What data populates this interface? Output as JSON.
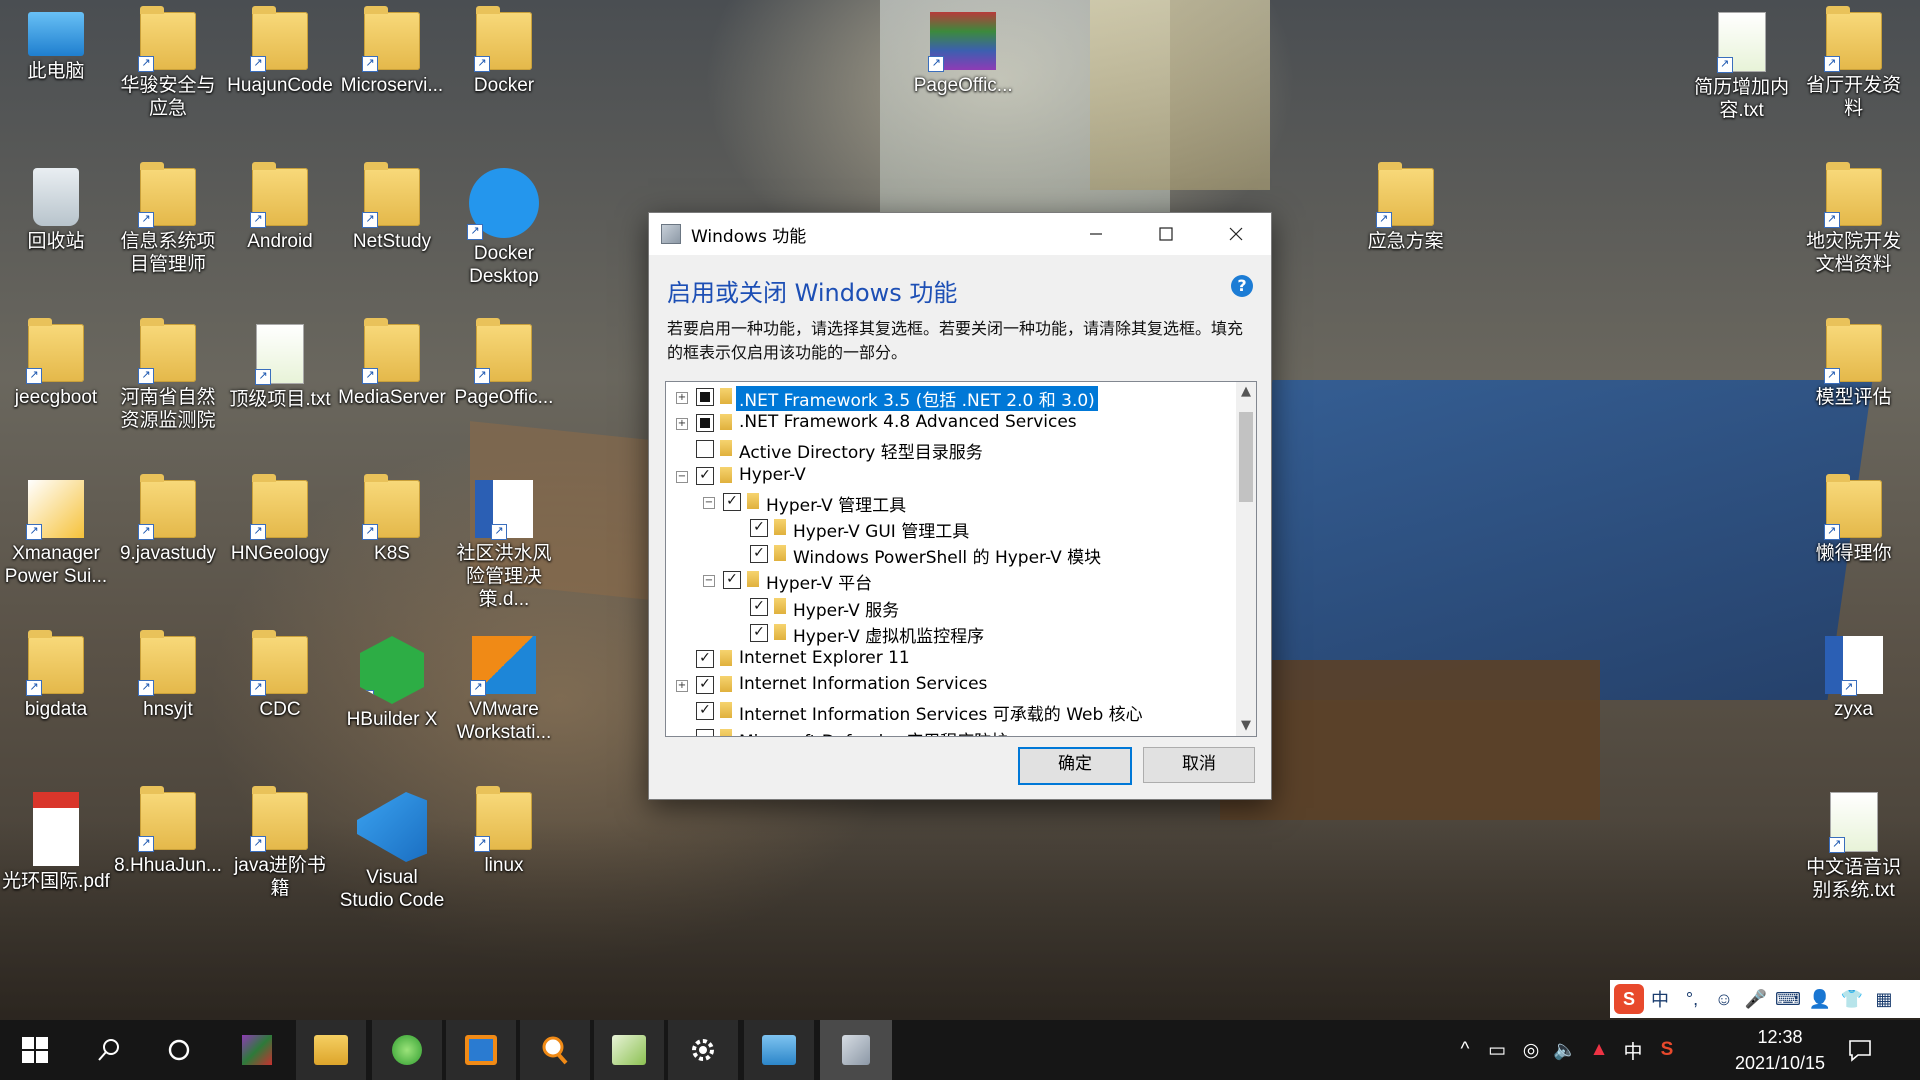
{
  "desktop": {
    "icons": [
      {
        "label": "此电脑"
      },
      {
        "label": "华骏安全与应急"
      },
      {
        "label": "HuajunCode"
      },
      {
        "label": "Microservi..."
      },
      {
        "label": "Docker"
      },
      {
        "label": "PageOffic..."
      },
      {
        "label": "简历增加内容.txt"
      },
      {
        "label": "省厅开发资料"
      },
      {
        "label": "回收站"
      },
      {
        "label": "信息系统项目管理师"
      },
      {
        "label": "Android"
      },
      {
        "label": "NetStudy"
      },
      {
        "label": "Docker Desktop"
      },
      {
        "label": "应急方案"
      },
      {
        "label": "地灾院开发文档资料"
      },
      {
        "label": "jeecgboot"
      },
      {
        "label": "河南省自然资源监测院"
      },
      {
        "label": "顶级项目.txt"
      },
      {
        "label": "MediaServer"
      },
      {
        "label": "PageOffic..."
      },
      {
        "label": "模型评估"
      },
      {
        "label": "Xmanager Power Sui..."
      },
      {
        "label": "9.javastudy"
      },
      {
        "label": "HNGeology"
      },
      {
        "label": "K8S"
      },
      {
        "label": "社区洪水风险管理决策.d..."
      },
      {
        "label": "懒得理你"
      },
      {
        "label": "bigdata"
      },
      {
        "label": "hnsyjt"
      },
      {
        "label": "CDC"
      },
      {
        "label": "HBuilder X"
      },
      {
        "label": "VMware Workstati..."
      },
      {
        "label": "zyxa"
      },
      {
        "label": "光环国际.pdf"
      },
      {
        "label": "8.HhuaJun..."
      },
      {
        "label": "java进阶书籍"
      },
      {
        "label": "Visual Studio Code"
      },
      {
        "label": "linux"
      },
      {
        "label": "中文语音识别系统.txt"
      }
    ]
  },
  "dialog": {
    "title": "Windows 功能",
    "heading": "启用或关闭 Windows 功能",
    "help": "?",
    "description": "若要启用一种功能，请选择其复选框。若要关闭一种功能，请清除其复选框。填充的框表示仅启用该功能的一部分。",
    "features": [
      {
        "label": ".NET Framework 3.5 (包括 .NET 2.0 和 3.0)",
        "state": "partial",
        "expander": "+",
        "selected": true
      },
      {
        "label": ".NET Framework 4.8 Advanced Services",
        "state": "partial",
        "expander": "+"
      },
      {
        "label": "Active Directory 轻型目录服务",
        "state": "unchecked",
        "expander": ""
      },
      {
        "label": "Hyper-V",
        "state": "checked",
        "expander": "−"
      },
      {
        "label": "Hyper-V 管理工具",
        "state": "checked",
        "expander": "−"
      },
      {
        "label": "Hyper-V GUI 管理工具",
        "state": "checked",
        "expander": ""
      },
      {
        "label": "Windows PowerShell 的 Hyper-V 模块",
        "state": "checked",
        "expander": ""
      },
      {
        "label": "Hyper-V 平台",
        "state": "checked",
        "expander": "−"
      },
      {
        "label": "Hyper-V 服务",
        "state": "checked",
        "expander": ""
      },
      {
        "label": "Hyper-V 虚拟机监控程序",
        "state": "checked",
        "expander": ""
      },
      {
        "label": "Internet Explorer 11",
        "state": "checked",
        "expander": ""
      },
      {
        "label": "Internet Information Services",
        "state": "checked",
        "expander": "+"
      },
      {
        "label": "Internet Information Services 可承载的 Web 核心",
        "state": "checked",
        "expander": ""
      },
      {
        "label": "Microsoft Defender 应用程序防护",
        "state": "unchecked",
        "expander": ""
      }
    ],
    "ok_label": "确定",
    "cancel_label": "取消"
  },
  "ime": {
    "logo": "S",
    "mode": "中",
    "punct": "°,"
  },
  "taskbar": {
    "apps": [
      "start",
      "search",
      "cortana",
      "winrar",
      "explorer",
      "360-browser",
      "remote",
      "search-tool",
      "notepad",
      "settings",
      "control-panel",
      "windows-features"
    ],
    "tray": {
      "ime_lang": "中"
    },
    "clock": {
      "time": "12:38",
      "date": "2021/10/15"
    }
  },
  "colors": {
    "accent": "#0078d7",
    "heading": "#1d4fb5",
    "taskbar": "#161616"
  }
}
